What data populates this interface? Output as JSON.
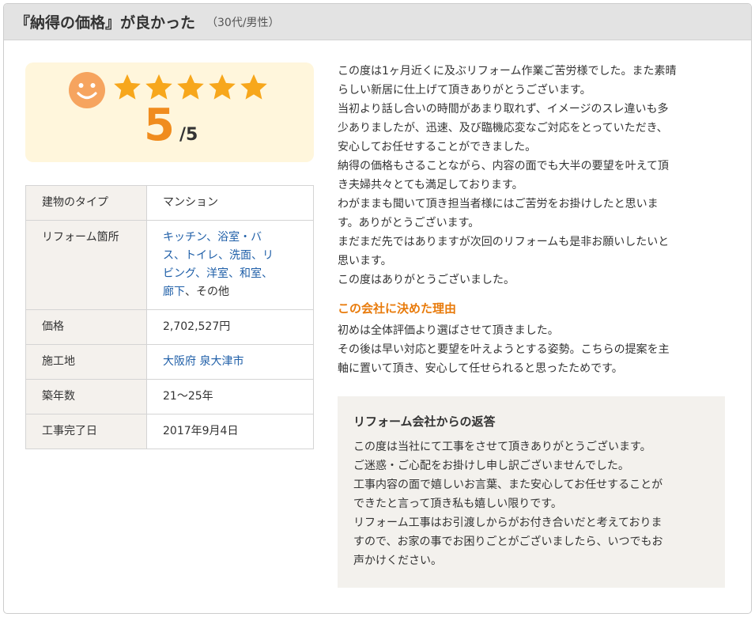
{
  "header": {
    "title": "『納得の価格』が良かった",
    "subtitle": "（30代/男性）"
  },
  "rating": {
    "score": "5",
    "max": "/5",
    "stars": 5,
    "icon": "smiley-icon",
    "star_color": "#f7a71c",
    "smiley_color": "#f6a45f"
  },
  "info": {
    "building_type": {
      "label": "建物のタイプ",
      "value": "マンション"
    },
    "locations": {
      "label": "リフォーム箇所",
      "line1": "キッチン、浴室・バ",
      "line2": "ス、トイレ、洗面、リ",
      "line3": "ビング、洋室、和室、",
      "line4_link": "廊下",
      "line4_rest": "、その他"
    },
    "price": {
      "label": "価格",
      "value": "2,702,527円"
    },
    "site": {
      "label": "施工地",
      "value": "大阪府 泉大津市"
    },
    "age": {
      "label": "築年数",
      "value": "21～25年"
    },
    "completion": {
      "label": "工事完了日",
      "value": "2017年9月4日"
    }
  },
  "review": {
    "lines": [
      "この度は1ヶ月近くに及ぶリフォーム作業ご苦労様でした。また素晴",
      "らしい新居に仕上げて頂きありがとうございます。",
      "当初より話し合いの時間があまり取れず、イメージのスレ違いも多",
      "少ありましたが、迅速、及び臨機応変なご対応をとっていただき、",
      "安心してお任せすることができました。",
      "納得の価格もさることながら、内容の面でも大半の要望を叶えて頂",
      "き夫婦共々とても満足しております。",
      "わがままも聞いて頂き担当者様にはご苦労をお掛けしたと思いま",
      "す。ありがとうございます。",
      "まだまだ先ではありますが次回のリフォームも是非お願いしたいと",
      "思います。",
      "この度はありがとうございました。"
    ]
  },
  "reason": {
    "heading": "この会社に決めた理由",
    "lines": [
      "初めは全体評価より選ばさせて頂きました。",
      "その後は早い対応と要望を叶えようとする姿勢。こちらの提案を主",
      "軸に置いて頂き、安心して任せられると思ったためです。"
    ]
  },
  "reply": {
    "heading": "リフォーム会社からの返答",
    "lines": [
      "この度は当社にて工事をさせて頂きありがとうございます。",
      "ご迷惑・ご心配をお掛けし申し訳ございませんでした。",
      "工事内容の面で嬉しいお言葉、また安心してお任せすることが",
      "できたと言って頂き私も嬉しい限りです。",
      "リフォーム工事はお引渡しからがお付き合いだと考えておりま",
      "すので、お家の事でお困りごとがございましたら、いつでもお",
      "声かけください。"
    ]
  }
}
